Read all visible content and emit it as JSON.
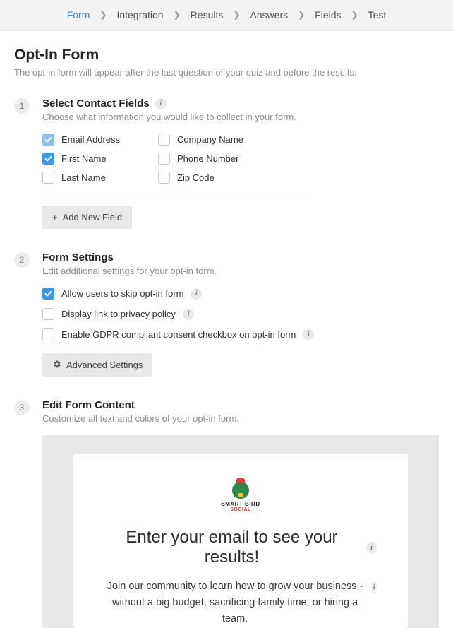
{
  "nav": {
    "items": [
      {
        "label": "Form",
        "active": true
      },
      {
        "label": "Integration"
      },
      {
        "label": "Results"
      },
      {
        "label": "Answers"
      },
      {
        "label": "Fields"
      },
      {
        "label": "Test"
      }
    ]
  },
  "page": {
    "title": "Opt-In Form",
    "desc": "The opt-in form will appear after the last question of your quiz and before the results."
  },
  "step1": {
    "num": "1",
    "title": "Select Contact Fields",
    "desc": "Choose what information you would like to collect in your form.",
    "fields": {
      "email": "Email Address",
      "company": "Company Name",
      "first": "First Name",
      "phone": "Phone Number",
      "last": "Last Name",
      "zip": "Zip Code"
    },
    "add_button": "Add New Field"
  },
  "step2": {
    "num": "2",
    "title": "Form Settings",
    "desc": "Edit additional settings for your opt-in form.",
    "options": {
      "skip": "Allow users to skip opt-in form",
      "privacy": "Display link to privacy policy",
      "gdpr": "Enable GDPR compliant consent checkbox on opt-in form"
    },
    "adv_button": "Advanced Settings"
  },
  "step3": {
    "num": "3",
    "title": "Edit Form Content",
    "desc": "Customize all text and colors of your opt-in form."
  },
  "preview": {
    "logo_text": "SMART BIRD",
    "logo_sub": "SOCIAL",
    "heading": "Enter your email to see your results!",
    "sub": "Join our community to learn how to grow your business - without a big budget, sacrificing family time, or hiring a team."
  }
}
